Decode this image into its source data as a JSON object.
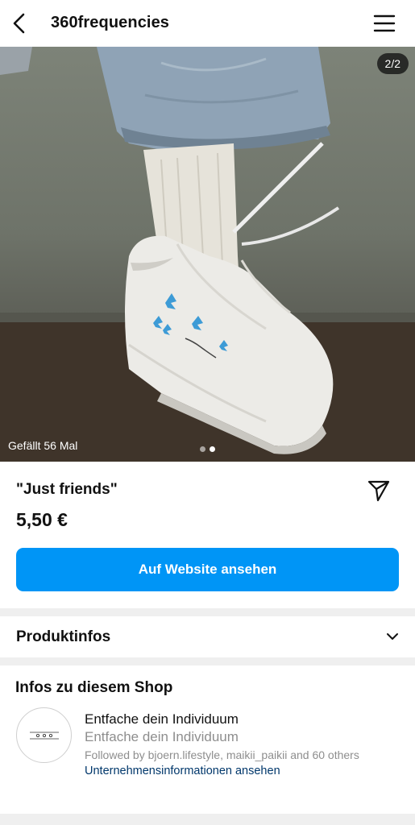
{
  "header": {
    "title": "360frequencies"
  },
  "post": {
    "counter": "2/2",
    "likes": "Gefällt 56 Mal",
    "image_count": 2,
    "active_image": 2
  },
  "product": {
    "name": "\"Just friends\"",
    "price": "5,50 €",
    "cta_label": "Auf Website ansehen"
  },
  "product_info": {
    "label": "Produktinfos"
  },
  "shop": {
    "heading": "Infos zu diesem Shop",
    "name": "Entfache dein Individuum",
    "subtitle": "Entfache dein Individuum",
    "followed_by": "Followed by bjoern.lifestyle, maikii_paikii and 60 others",
    "link": "Unternehmensinformationen ansehen",
    "avatar_text": "ᴗ ॰ ॰"
  },
  "colors": {
    "accent": "#0095f6",
    "link": "#00376b",
    "muted": "#8e8e8e",
    "separator": "#efefef"
  },
  "icons": {
    "back": "chevron-left-icon",
    "menu": "hamburger-menu-icon",
    "share": "paper-plane-icon",
    "expand": "chevron-down-icon"
  }
}
